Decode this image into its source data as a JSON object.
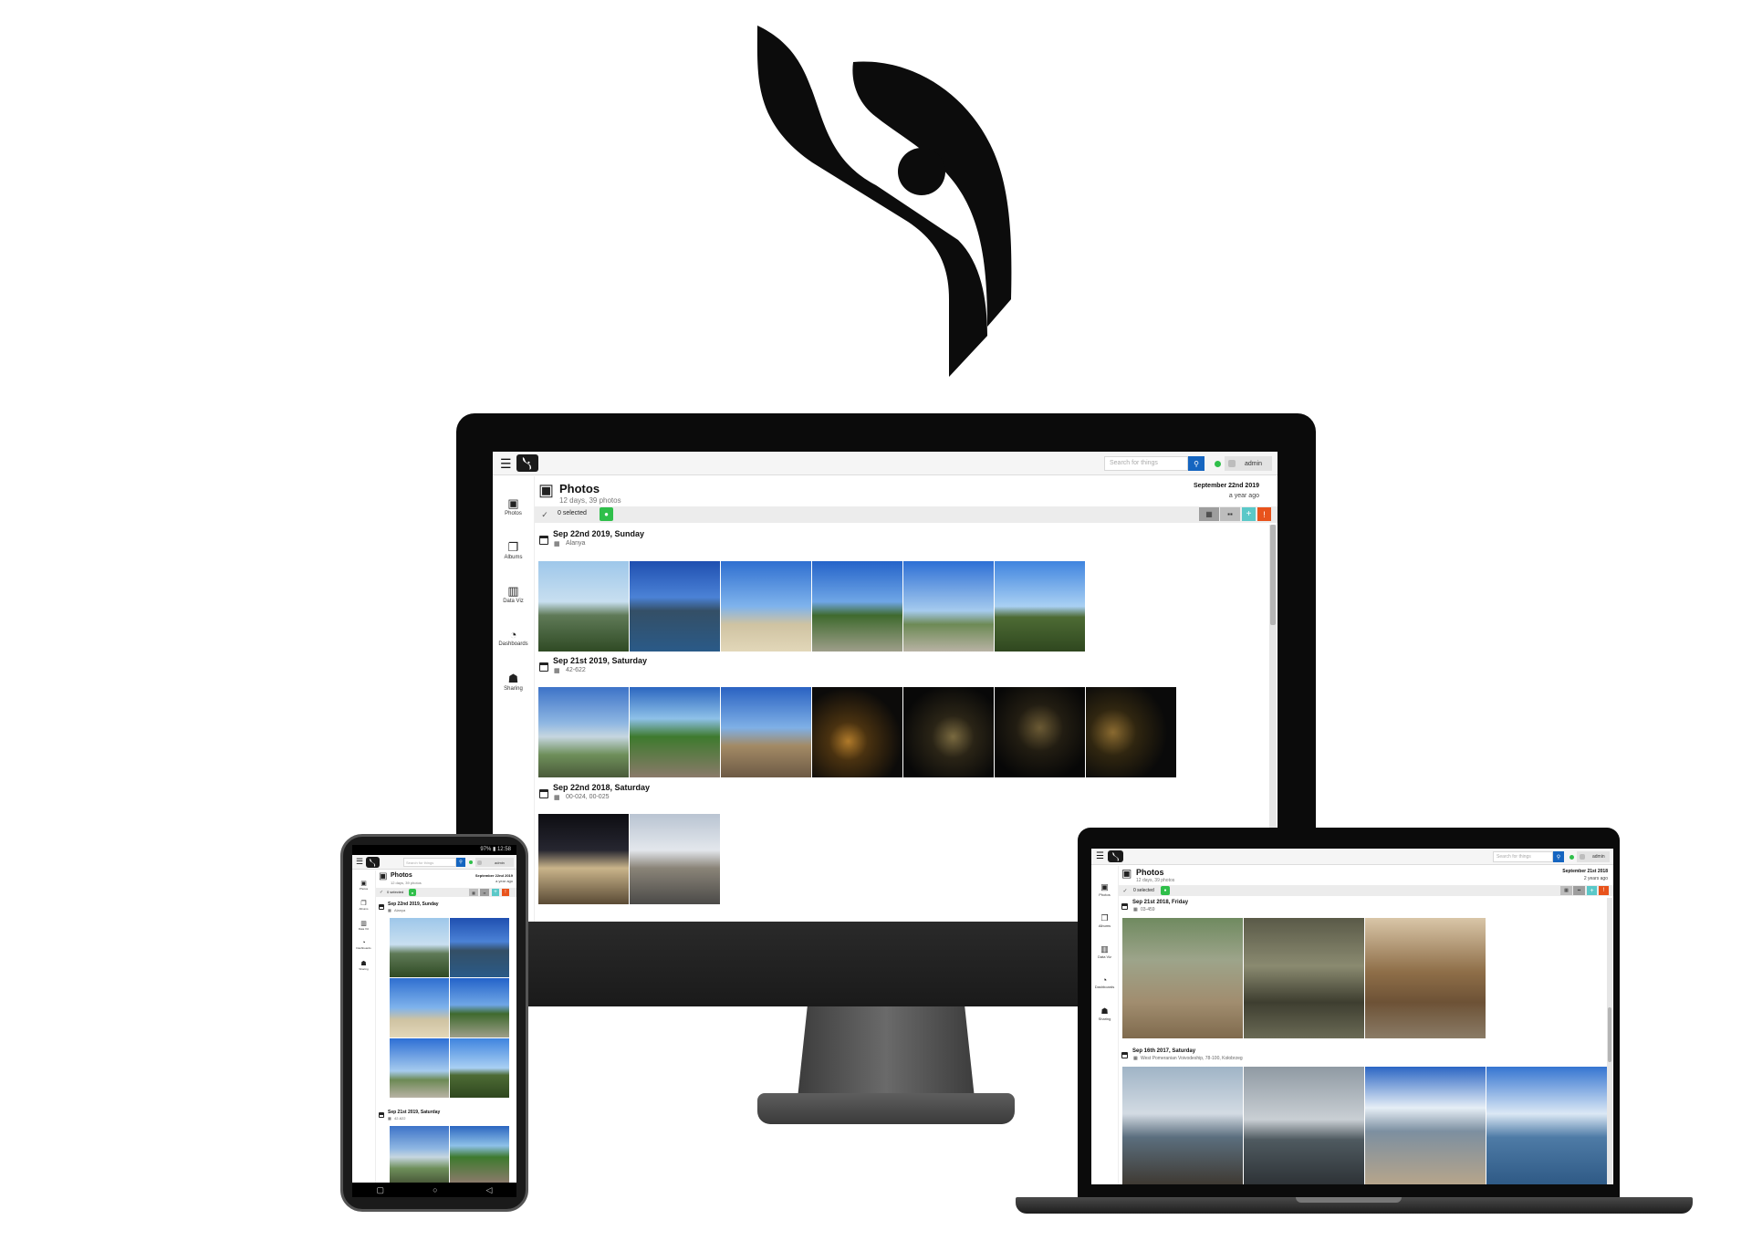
{
  "brand": {
    "accent": "#1565c0",
    "online": "#2fbf4a",
    "add": "#5ac8c8",
    "alert": "#e8531c"
  },
  "icons": [
    "menu-icon",
    "search-icon",
    "user-icon",
    "photos-icon",
    "albums-icon",
    "data-viz-icon",
    "dashboards-icon",
    "sharing-icon",
    "calendar-icon",
    "map-icon",
    "check-icon"
  ],
  "nav": {
    "items": [
      {
        "label": "Photos"
      },
      {
        "label": "Albums"
      },
      {
        "label": "Data Viz"
      },
      {
        "label": "Dashboards"
      },
      {
        "label": "Sharing"
      }
    ]
  },
  "search": {
    "placeholder": "Search for things"
  },
  "user": {
    "name": "admin"
  },
  "toolbar": {
    "selected": "0 selected"
  },
  "desktop": {
    "title": "Photos",
    "subtitle": "12 days, 39 photos",
    "date": "September 22nd 2019",
    "ago": "a year ago",
    "groups": [
      {
        "title": "Sep 22nd 2019, Sunday",
        "location": "Alanya"
      },
      {
        "title": "Sep 21st 2019, Saturday",
        "location": "42-622"
      },
      {
        "title": "Sep 22nd 2018, Saturday",
        "location": "00-024, 00-025"
      }
    ]
  },
  "laptop": {
    "title": "Photos",
    "subtitle": "12 days, 39 photos",
    "date": "September 21st 2018",
    "ago": "2 years ago",
    "groups": [
      {
        "title": "Sep 21st 2018, Friday",
        "location": "03-459"
      },
      {
        "title": "Sep 16th 2017, Saturday",
        "location": "West Pomeranian Voivodeship, 78-100, Kołobrzeg"
      }
    ]
  },
  "phone": {
    "status": "97% ▮ 12:58",
    "title": "Photos",
    "subtitle": "12 days, 39 photos",
    "date": "September 22nd 2019",
    "ago": "a year ago",
    "groups": [
      {
        "title": "Sep 22nd 2019, Sunday",
        "location": "Alanya"
      },
      {
        "title": "Sep 21st 2019, Saturday",
        "location": "42-622"
      }
    ]
  }
}
